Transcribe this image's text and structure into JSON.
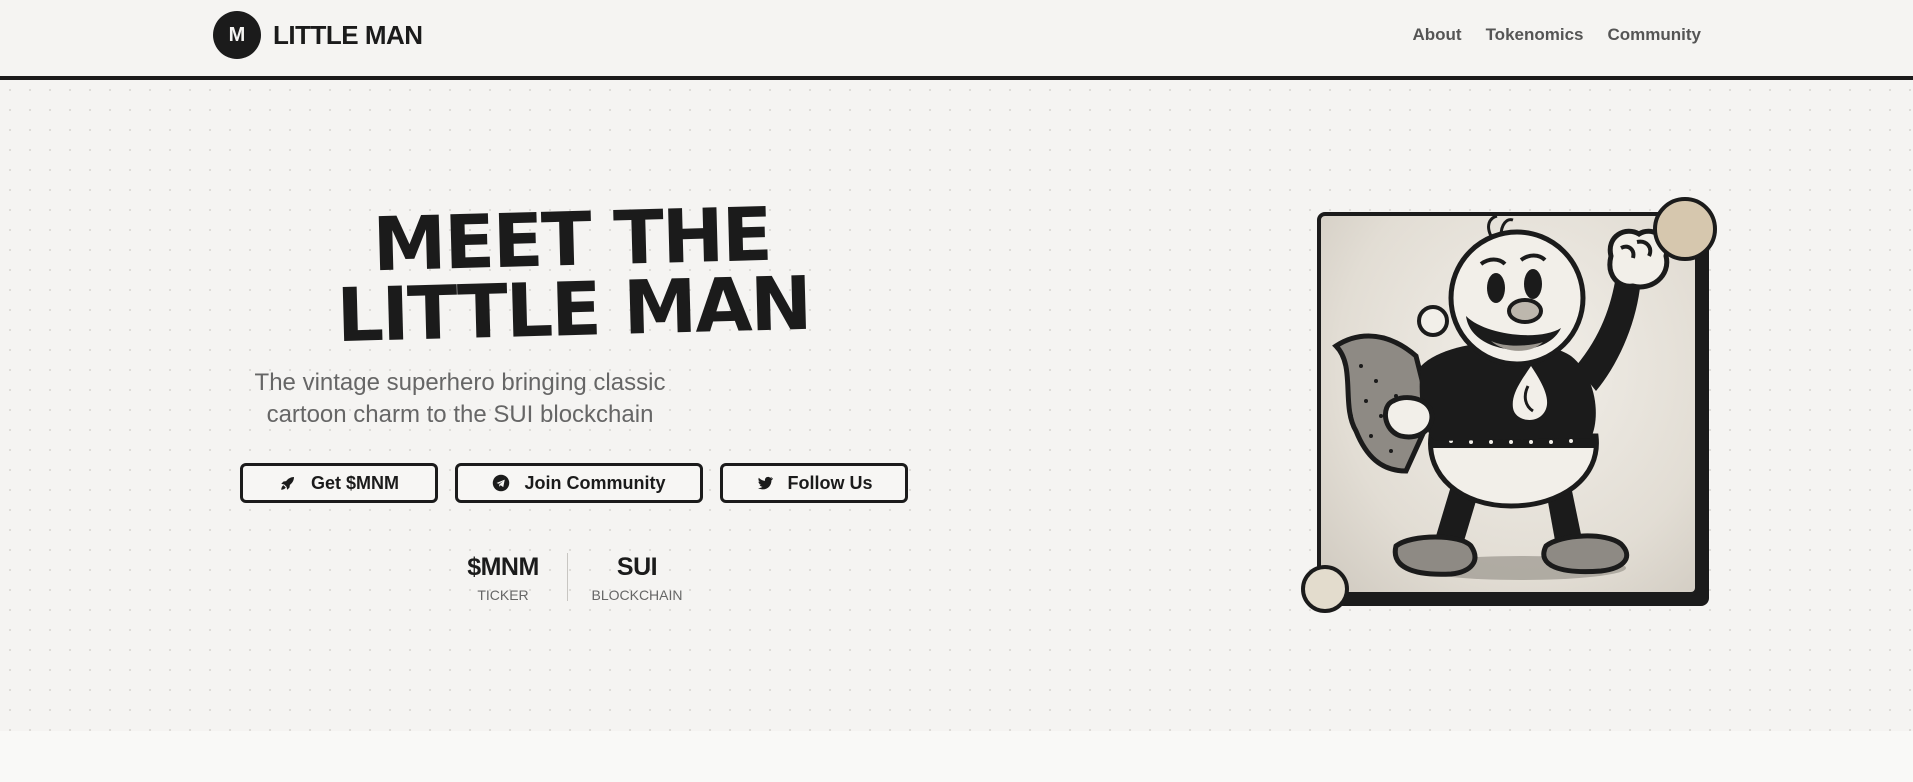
{
  "header": {
    "logo_letter": "M",
    "brand_name": "LITTLE MAN",
    "nav": [
      "About",
      "Tokenomics",
      "Community"
    ]
  },
  "hero": {
    "headline_line1": "MEET THE",
    "headline_line2": "LITTLE MAN",
    "subtitle": "The vintage superhero bringing classic cartoon charm to the SUI blockchain",
    "buttons": {
      "get": {
        "label": "Get $MNM",
        "icon": "rocket-icon"
      },
      "join": {
        "label": "Join Community",
        "icon": "telegram-icon"
      },
      "follow": {
        "label": "Follow Us",
        "icon": "twitter-icon"
      }
    },
    "stats": [
      {
        "value": "$MNM",
        "label": "TICKER"
      },
      {
        "value": "SUI",
        "label": "BLOCKCHAIN"
      }
    ]
  },
  "colors": {
    "ink": "#1b1b1b",
    "background": "#f5f4f2",
    "muted_text": "#666666",
    "coin_gold": "#d6c7ae"
  }
}
